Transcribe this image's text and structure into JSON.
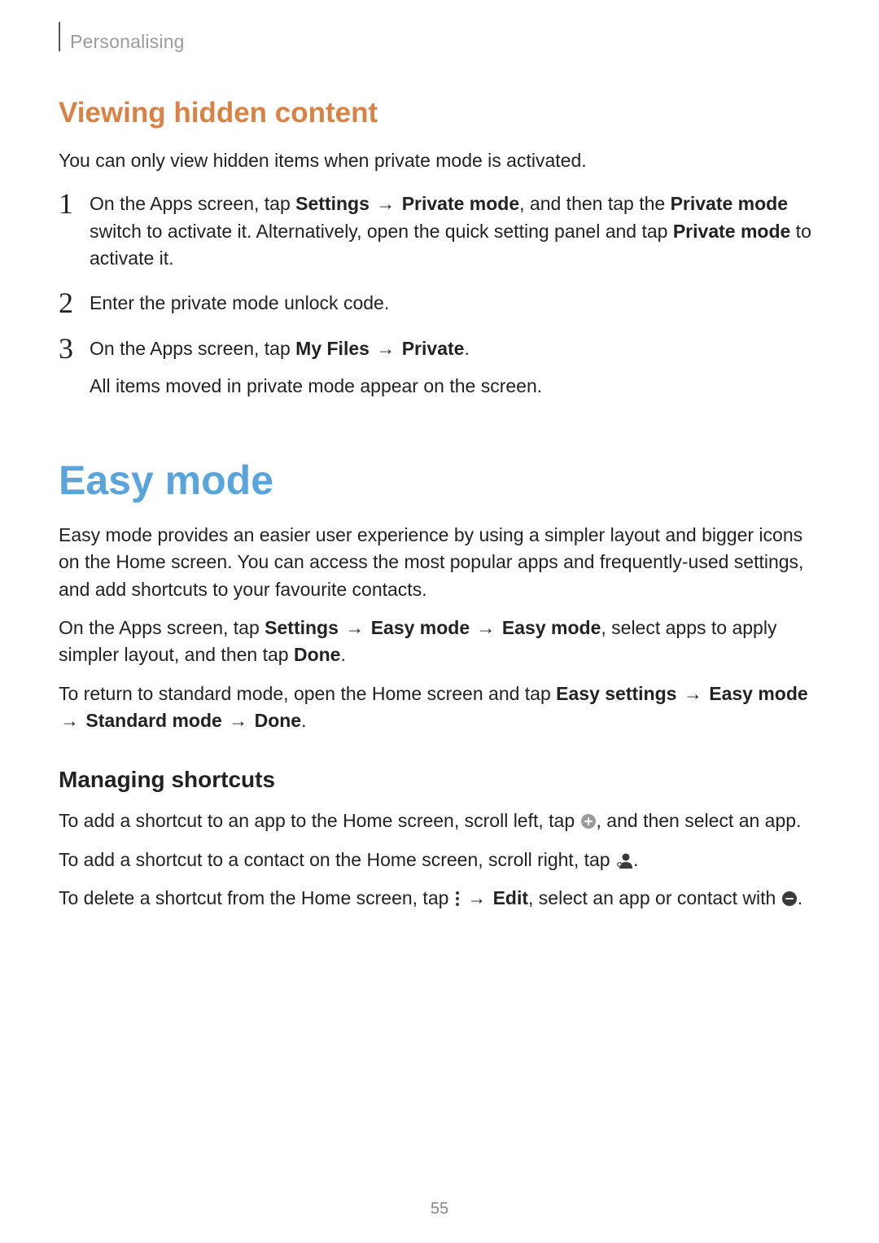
{
  "breadcrumb": "Personalising",
  "section_heading": "Viewing hidden content",
  "section_intro": "You can only view hidden items when private mode is activated.",
  "steps": [
    {
      "num": "1",
      "parts": [
        {
          "t": "On the Apps screen, tap "
        },
        {
          "b": "Settings"
        },
        {
          "t": " "
        },
        {
          "arrow": "→"
        },
        {
          "t": " "
        },
        {
          "b": "Private mode"
        },
        {
          "t": ", and then tap the "
        },
        {
          "b": "Private mode"
        },
        {
          "t": " switch to activate it. Alternatively, open the quick setting panel and tap "
        },
        {
          "b": "Private mode"
        },
        {
          "t": " to activate it."
        }
      ]
    },
    {
      "num": "2",
      "parts": [
        {
          "t": "Enter the private mode unlock code."
        }
      ]
    },
    {
      "num": "3",
      "parts": [
        {
          "t": "On the Apps screen, tap "
        },
        {
          "b": "My Files"
        },
        {
          "t": " "
        },
        {
          "arrow": "→"
        },
        {
          "t": " "
        },
        {
          "b": "Private"
        },
        {
          "t": "."
        }
      ],
      "sub": "All items moved in private mode appear on the screen."
    }
  ],
  "h1": "Easy mode",
  "easy_para1": "Easy mode provides an easier user experience by using a simpler layout and bigger icons on the Home screen. You can access the most popular apps and frequently-used settings, and add shortcuts to your favourite contacts.",
  "easy_para2_parts": [
    {
      "t": "On the Apps screen, tap "
    },
    {
      "b": "Settings"
    },
    {
      "t": " "
    },
    {
      "arrow": "→"
    },
    {
      "t": " "
    },
    {
      "b": "Easy mode"
    },
    {
      "t": " "
    },
    {
      "arrow": "→"
    },
    {
      "t": " "
    },
    {
      "b": "Easy mode"
    },
    {
      "t": ", select apps to apply simpler layout, and then tap "
    },
    {
      "b": "Done"
    },
    {
      "t": "."
    }
  ],
  "easy_para3_parts": [
    {
      "t": "To return to standard mode, open the Home screen and tap "
    },
    {
      "b": "Easy settings"
    },
    {
      "t": " "
    },
    {
      "arrow": "→"
    },
    {
      "t": " "
    },
    {
      "b": "Easy mode"
    },
    {
      "t": " "
    },
    {
      "arrow": "→"
    },
    {
      "t": " "
    },
    {
      "b": "Standard mode"
    },
    {
      "t": " "
    },
    {
      "arrow": "→"
    },
    {
      "t": " "
    },
    {
      "b": "Done"
    },
    {
      "t": "."
    }
  ],
  "h3_shortcuts": "Managing shortcuts",
  "shortcuts_p1_parts": [
    {
      "t": "To add a shortcut to an app to the Home screen, scroll left, tap "
    },
    {
      "icon": "plus-circle"
    },
    {
      "t": ", and then select an app."
    }
  ],
  "shortcuts_p2_parts": [
    {
      "t": "To add a shortcut to a contact on the Home screen, scroll right, tap "
    },
    {
      "icon": "add-contact"
    },
    {
      "t": "."
    }
  ],
  "shortcuts_p3_parts": [
    {
      "t": "To delete a shortcut from the Home screen, tap "
    },
    {
      "icon": "more-menu"
    },
    {
      "t": " "
    },
    {
      "arrow": "→"
    },
    {
      "t": " "
    },
    {
      "b": "Edit"
    },
    {
      "t": ", select an app or contact with "
    },
    {
      "icon": "minus-circle"
    },
    {
      "t": "."
    }
  ],
  "page_number": "55",
  "colors": {
    "h1": "#5aa4dc",
    "h2": "#d98246"
  }
}
